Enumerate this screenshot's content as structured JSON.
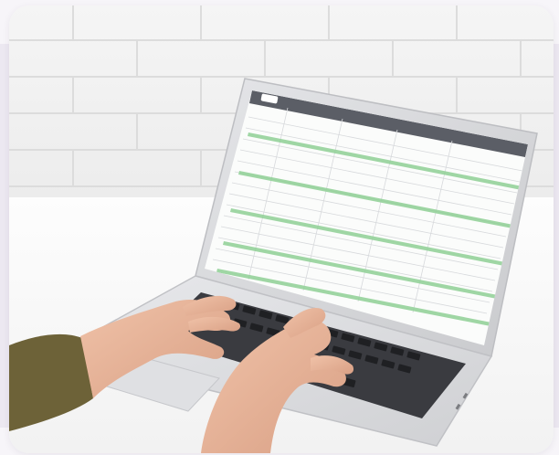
{
  "scene": {
    "subject": "laptop-on-desk",
    "screen_content": "spreadsheet",
    "colors": {
      "accent_green": "#8fcf95",
      "backdrop": "#ece8f1",
      "wall": "#f1f1f1",
      "desk": "#fbfbfb",
      "laptop_body": "#d9dadd",
      "keys": "#2f3034",
      "skin": "#e9b59b",
      "sleeve": "#6d6238"
    }
  }
}
